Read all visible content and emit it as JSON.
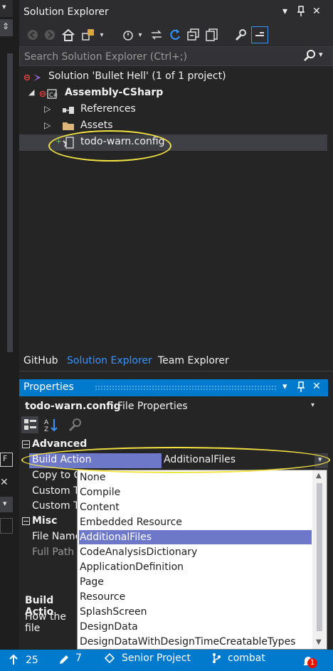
{
  "solution_explorer": {
    "title": "Solution Explorer",
    "search_placeholder": "Search Solution Explorer (Ctrl+;)",
    "tree": {
      "solution": "Solution 'Bullet Hell' (1 of 1 project)",
      "project": "Assembly-CSharp",
      "references": "References",
      "assets": "Assets",
      "config": "todo-warn.config"
    }
  },
  "bottom_tabs": [
    "GitHub",
    "Solution Explorer",
    "Team Explorer"
  ],
  "properties": {
    "title": "Properties",
    "object_name": "todo-warn.config",
    "object_type": "File Properties",
    "categories": {
      "advanced": "Advanced",
      "misc": "Misc"
    },
    "rows": {
      "build_action": "Build Action",
      "build_action_value": "AdditionalFiles",
      "copy_to": "Copy to C",
      "custom_tool": "Custom To",
      "custom_tool_ns": "Custom To",
      "file_name": "File Name",
      "full_path": "Full Path"
    },
    "description": {
      "title": "Build Actio",
      "text": "How the file"
    }
  },
  "dropdown_options": [
    "None",
    "Compile",
    "Content",
    "Embedded Resource",
    "AdditionalFiles",
    "CodeAnalysisDictionary",
    "ApplicationDefinition",
    "Page",
    "Resource",
    "SplashScreen",
    "DesignData",
    "DesignDataWithDesignTimeCreatableTypes"
  ],
  "dropdown_selected": "AdditionalFiles",
  "status_bar": {
    "count": "25",
    "pencil_count": "7",
    "project": "Senior Project",
    "branch": "combat",
    "notification_count": "1"
  },
  "colors": {
    "accent": "#007acc",
    "selection": "#6e78c8",
    "highlight_ring": "#f5e342"
  }
}
